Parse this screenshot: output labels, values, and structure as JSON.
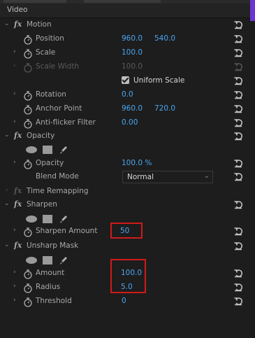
{
  "panel": {
    "title": "Video"
  },
  "motion": {
    "name": "Motion",
    "position": {
      "label": "Position",
      "x": "960.0",
      "y": "540.0"
    },
    "scale": {
      "label": "Scale",
      "value": "100.0"
    },
    "scale_width": {
      "label": "Scale Width",
      "value": "100.0"
    },
    "uniform_scale": {
      "label": "Uniform Scale"
    },
    "rotation": {
      "label": "Rotation",
      "value": "0.0"
    },
    "anchor_point": {
      "label": "Anchor Point",
      "x": "960.0",
      "y": "720.0"
    },
    "anti_flicker": {
      "label": "Anti-flicker Filter",
      "value": "0.00"
    }
  },
  "opacity": {
    "name": "Opacity",
    "opacity": {
      "label": "Opacity",
      "value": "100.0 %"
    },
    "blend_mode": {
      "label": "Blend Mode",
      "value": "Normal"
    }
  },
  "time_remapping": {
    "name": "Time Remapping"
  },
  "sharpen": {
    "name": "Sharpen",
    "amount": {
      "label": "Sharpen Amount",
      "value": "50"
    }
  },
  "unsharp_mask": {
    "name": "Unsharp Mask",
    "amount": {
      "label": "Amount",
      "value": "100.0"
    },
    "radius": {
      "label": "Radius",
      "value": "5.0"
    },
    "threshold": {
      "label": "Threshold",
      "value": "0"
    }
  },
  "colors": {
    "accent": "#4aa6f1",
    "highlight": "#d11a1a",
    "background": "#1d1d1d"
  },
  "icons": [
    "chevron-right-icon",
    "chevron-down-icon",
    "fx-icon",
    "stopwatch-icon",
    "reset-icon",
    "ellipse-mask-icon",
    "rectangle-mask-icon",
    "pen-mask-icon"
  ]
}
